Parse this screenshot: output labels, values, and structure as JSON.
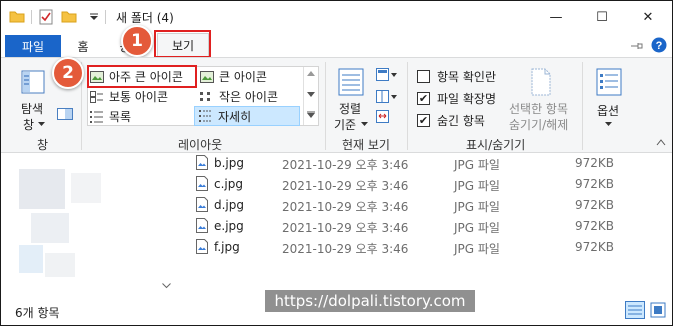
{
  "window": {
    "title": "새 폴더 (4)",
    "minimize_glyph": "—",
    "maximize_glyph": "☐",
    "close_glyph": "✕"
  },
  "tabs": {
    "file": "파일",
    "home": "홈",
    "share": "공",
    "view": "보기"
  },
  "annotations": {
    "step1": "1",
    "step2": "2"
  },
  "ribbon": {
    "pane": {
      "nav_pane_line1": "탐색",
      "nav_pane_line2": "창",
      "label": "창"
    },
    "layout": {
      "label": "레이아웃",
      "items": [
        {
          "label": "아주 큰 아이콘"
        },
        {
          "label": "큰 아이콘"
        },
        {
          "label": "보통 아이콘"
        },
        {
          "label": "작은 아이콘"
        },
        {
          "label": "목록"
        },
        {
          "label": "자세히"
        }
      ]
    },
    "current_view": {
      "label": "현재 보기",
      "sort_line1": "정렬",
      "sort_line2": "기준"
    },
    "show_hide": {
      "label": "표시/숨기기",
      "checkboxes": [
        {
          "label": "항목 확인란",
          "checked": false
        },
        {
          "label": "파일 확장명",
          "checked": true
        },
        {
          "label": "숨긴 항목",
          "checked": true
        }
      ],
      "hide_selected_line1": "선택한 항목",
      "hide_selected_line2": "숨기기/해제"
    },
    "options": {
      "label": "옵션"
    }
  },
  "files": [
    {
      "name": "b.jpg",
      "date": "2021-10-29 오후 3:46",
      "type": "JPG 파일",
      "size": "972KB"
    },
    {
      "name": "c.jpg",
      "date": "2021-10-29 오후 3:46",
      "type": "JPG 파일",
      "size": "972KB"
    },
    {
      "name": "d.jpg",
      "date": "2021-10-29 오후 3:46",
      "type": "JPG 파일",
      "size": "972KB"
    },
    {
      "name": "e.jpg",
      "date": "2021-10-29 오후 3:46",
      "type": "JPG 파일",
      "size": "972KB"
    },
    {
      "name": "f.jpg",
      "date": "2021-10-29 오후 3:46",
      "type": "JPG 파일",
      "size": "972KB"
    }
  ],
  "status": {
    "item_count": "6개 항목"
  },
  "watermark": "https://dolpali.tistory.com",
  "colors": {
    "accent": "#1a65c9",
    "highlight_box": "#e02020",
    "badge": "#e45a3a",
    "selected_item": "#cce8ff"
  }
}
